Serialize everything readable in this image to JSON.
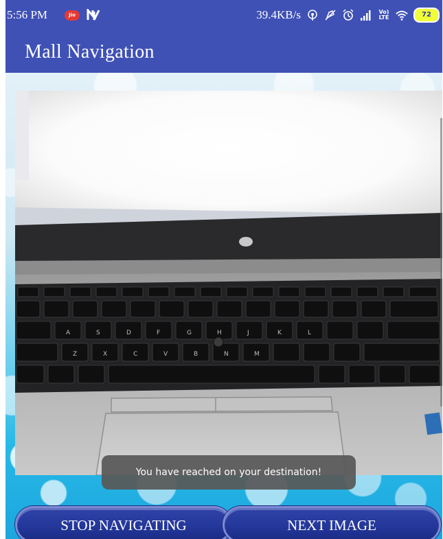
{
  "status_bar": {
    "time": "5:56 PM",
    "jio_badge": "Jio",
    "net_speed": "39.4KB/s",
    "lte_label_top": "Vo)",
    "lte_label_bottom": "LTE",
    "battery_level": "72",
    "icons": [
      "jio-notification-icon",
      "n-notification-icon",
      "hotspot-icon",
      "mute-icon",
      "alarm-icon",
      "signal-icon",
      "volte-icon",
      "wifi-icon",
      "battery-icon"
    ]
  },
  "app_bar": {
    "title": "Mall Navigation"
  },
  "camera_preview": {
    "subject": "laptop-keyboard-photo"
  },
  "toast": {
    "message": "You have reached on your destination!"
  },
  "buttons": {
    "stop_label": "STOP NAVIGATING",
    "next_label": "NEXT IMAGE"
  },
  "colors": {
    "primary": "#3f51b5",
    "button": "#24379a",
    "toast": "#585858",
    "battery": "#f0ff3a"
  }
}
